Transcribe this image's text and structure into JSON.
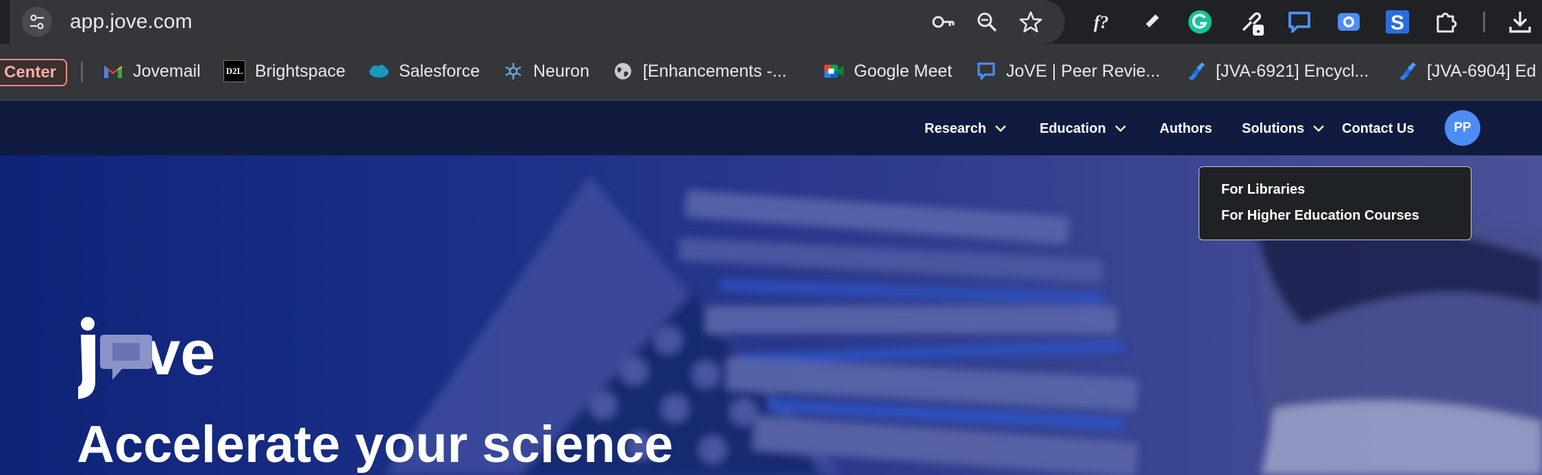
{
  "browser": {
    "url": "app.jove.com",
    "toolbar_icons": [
      "tune-icon",
      "key-icon",
      "zoom-icon",
      "star-icon"
    ],
    "extensions": [
      "formula-icon",
      "pencil-icon",
      "grammarly-icon",
      "eyedropper-icon",
      "chat-icon",
      "screencast-icon",
      "s-icon",
      "puzzle-icon",
      "download-icon"
    ]
  },
  "bookmarks": {
    "pinned_label": "Center",
    "items": [
      {
        "label": "Jovemail",
        "icon": "gmail-icon"
      },
      {
        "label": "Brightspace",
        "icon": "d2l-icon",
        "icon_text": "D2L"
      },
      {
        "label": "Salesforce",
        "icon": "salesforce-icon"
      },
      {
        "label": "Neuron",
        "icon": "neuron-icon"
      },
      {
        "label": "[Enhancements -...",
        "icon": "globe-icon"
      },
      {
        "label": "Google Meet",
        "icon": "meet-icon"
      },
      {
        "label": "JoVE | Peer Revie...",
        "icon": "chat-icon"
      },
      {
        "label": "[JVA-6921] Encycl...",
        "icon": "jira-icon"
      },
      {
        "label": "[JVA-6904] Ed",
        "icon": "jira-icon"
      }
    ]
  },
  "nav": {
    "items": [
      {
        "label": "Research",
        "has_menu": true
      },
      {
        "label": "Education",
        "has_menu": true
      },
      {
        "label": "Authors",
        "has_menu": false
      },
      {
        "label": "Solutions",
        "has_menu": true
      },
      {
        "label": "Contact Us",
        "has_menu": false
      }
    ],
    "avatar_initials": "PP"
  },
  "solutions_menu": {
    "items": [
      "For Libraries",
      "For Higher Education Courses"
    ]
  },
  "hero": {
    "logo_text": "jove",
    "headline": "Accelerate your science"
  },
  "colors": {
    "nav_bg": "#111b3f",
    "hero_blue": "#1b2f87",
    "avatar": "#4d8cf5",
    "pill_border": "#f28b82"
  }
}
